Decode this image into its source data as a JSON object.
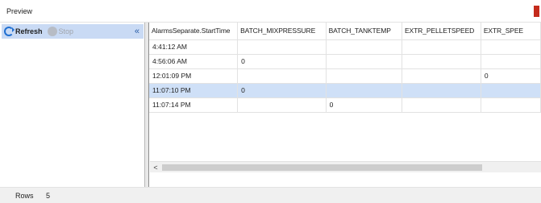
{
  "panel": {
    "title": "Preview"
  },
  "toolbar": {
    "refresh_label": "Refresh",
    "stop_label": "Stop",
    "collapse_glyph": "«"
  },
  "grid": {
    "columns": [
      "AlarmsSeparate.StartTime",
      "BATCH_MIXPRESSURE",
      "BATCH_TANKTEMP",
      "EXTR_PELLETSPEED",
      "EXTR_SPEE"
    ],
    "rows": [
      [
        "4:41:12 AM",
        "",
        "",
        "",
        ""
      ],
      [
        "4:56:06 AM",
        "0",
        "",
        "",
        ""
      ],
      [
        "12:01:09 PM",
        "",
        "",
        "",
        "0"
      ],
      [
        "11:07:10 PM",
        "0",
        "",
        "",
        ""
      ],
      [
        "11:07:14 PM",
        "",
        "0",
        "",
        ""
      ]
    ],
    "selected_row": 3
  },
  "scrollbar": {
    "left_arrow": "<"
  },
  "status": {
    "rows_label": "Rows",
    "rows_count": "5"
  },
  "colors": {
    "selection": "#cfe0f7",
    "toolbar_bg": "#c9daf4",
    "accent": "#c42b1c"
  }
}
